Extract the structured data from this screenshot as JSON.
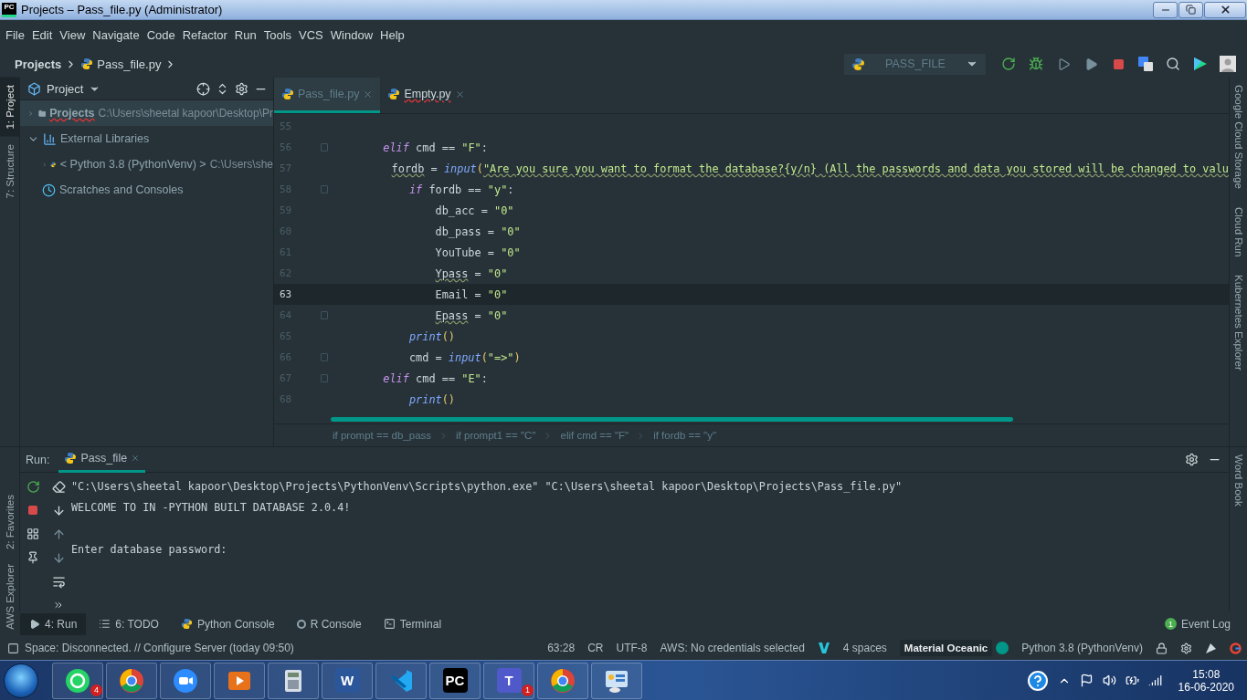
{
  "window": {
    "title": "Projects – Pass_file.py (Administrator)",
    "app_icon": "PC"
  },
  "menu": [
    "File",
    "Edit",
    "View",
    "Navigate",
    "Code",
    "Refactor",
    "Run",
    "Tools",
    "VCS",
    "Window",
    "Help"
  ],
  "breadcrumbs": [
    "Projects",
    "Pass_file.py"
  ],
  "run_config": {
    "label": "PASS_FILE"
  },
  "left_stripe": [
    {
      "label": "1: Project",
      "selected": true
    },
    {
      "label": "7: Structure",
      "selected": false
    }
  ],
  "project_panel": {
    "title": "Project",
    "tree": [
      {
        "label": "Projects",
        "path": "C:\\Users\\sheetal kapoor\\Desktop\\Pr",
        "kind": "folder",
        "expanded": false,
        "selected": true,
        "error": true
      },
      {
        "label": "External Libraries",
        "kind": "library",
        "expanded": true,
        "selected": false,
        "children": [
          {
            "label": "< Python 3.8 (PythonVenv) >",
            "path": "C:\\Users\\she",
            "kind": "python",
            "expanded": false,
            "selected": false
          }
        ]
      },
      {
        "label": "Scratches and Consoles",
        "kind": "scratches",
        "selected": false
      }
    ]
  },
  "editor_tabs": [
    {
      "label": "Pass_file.py",
      "selected": true,
      "error": false
    },
    {
      "label": "Empty.py",
      "selected": false,
      "error": true
    }
  ],
  "code_lines": [
    {
      "number": "55",
      "fold": false,
      "selected": false
    },
    {
      "number": "56",
      "fold": true,
      "selected": false,
      "tokens": [
        {
          "kind": "keyword",
          "text": "        elif"
        },
        {
          "kind": "plain",
          "text": " cmd == "
        },
        {
          "kind": "string",
          "text": "\"F\""
        },
        {
          "kind": "plain",
          "text": ":"
        }
      ]
    },
    {
      "number": "57",
      "fold": false,
      "selected": false,
      "tokens": [
        {
          "kind": "plain",
          "text": "            fordb",
          "squiggle": true
        },
        {
          "kind": "plain",
          "text": " = "
        },
        {
          "kind": "func",
          "text": "input"
        },
        {
          "kind": "bracket",
          "text": "("
        },
        {
          "kind": "string",
          "text": "\"Are you sure you want to format the database?{y/n} (All the passwords and data you stored will be changed to valu",
          "squiggle": true
        }
      ]
    },
    {
      "number": "58",
      "fold": true,
      "selected": false,
      "tokens": [
        {
          "kind": "keyword",
          "text": "            if"
        },
        {
          "kind": "plain",
          "text": " fordb == "
        },
        {
          "kind": "string",
          "text": "\"y\""
        },
        {
          "kind": "plain",
          "text": ":"
        }
      ]
    },
    {
      "number": "59",
      "fold": false,
      "selected": false,
      "tokens": [
        {
          "kind": "plain",
          "text": "                db_acc = "
        },
        {
          "kind": "string",
          "text": "\"0\""
        }
      ]
    },
    {
      "number": "60",
      "fold": false,
      "selected": false,
      "tokens": [
        {
          "kind": "plain",
          "text": "                db_pass = "
        },
        {
          "kind": "string",
          "text": "\"0\""
        }
      ]
    },
    {
      "number": "61",
      "fold": false,
      "selected": false,
      "tokens": [
        {
          "kind": "plain",
          "text": "                YouTube = "
        },
        {
          "kind": "string",
          "text": "\"0\""
        }
      ]
    },
    {
      "number": "62",
      "fold": false,
      "selected": false,
      "tokens": [
        {
          "kind": "plain",
          "text": "                Ypass",
          "squiggle": true
        },
        {
          "kind": "plain",
          "text": " = "
        },
        {
          "kind": "string",
          "text": "\"0\""
        }
      ]
    },
    {
      "number": "63",
      "fold": false,
      "selected": true,
      "tokens": [
        {
          "kind": "plain",
          "text": "                Email = "
        },
        {
          "kind": "string",
          "text": "\"0\""
        }
      ]
    },
    {
      "number": "64",
      "fold": true,
      "selected": false,
      "tokens": [
        {
          "kind": "plain",
          "text": "                Epass",
          "squiggle": true
        },
        {
          "kind": "plain",
          "text": " = "
        },
        {
          "kind": "string",
          "text": "\"0\""
        }
      ]
    },
    {
      "number": "65",
      "fold": false,
      "selected": false,
      "tokens": [
        {
          "kind": "func",
          "text": "            print"
        },
        {
          "kind": "bracket",
          "text": "()"
        }
      ]
    },
    {
      "number": "66",
      "fold": true,
      "selected": false,
      "tokens": [
        {
          "kind": "plain",
          "text": "            cmd = "
        },
        {
          "kind": "func",
          "text": "input"
        },
        {
          "kind": "bracket",
          "text": "("
        },
        {
          "kind": "string",
          "text": "\"=>\""
        },
        {
          "kind": "bracket",
          "text": ")"
        }
      ]
    },
    {
      "number": "67",
      "fold": true,
      "selected": false,
      "tokens": [
        {
          "kind": "keyword",
          "text": "        elif"
        },
        {
          "kind": "plain",
          "text": " cmd == "
        },
        {
          "kind": "string",
          "text": "\"E\""
        },
        {
          "kind": "plain",
          "text": ":"
        }
      ]
    },
    {
      "number": "68",
      "fold": false,
      "selected": false,
      "tokens": [
        {
          "kind": "func",
          "text": "            print"
        },
        {
          "kind": "bracket",
          "text": "()"
        }
      ]
    }
  ],
  "code_breadcrumbs": [
    "if prompt == db_pass",
    "if prompt1 == \"C\"",
    "elif cmd == \"F\"",
    "if fordb == \"y\""
  ],
  "right_stripe": [
    "Google Cloud Storage",
    "Cloud Run",
    "Kubernetes Explorer"
  ],
  "run_panel": {
    "label": "Run:",
    "tab": {
      "label": "Pass_file",
      "selected": true
    },
    "side_tabs": [
      "2: Favorites",
      "AWS Explorer"
    ],
    "right_tab": "Word Book",
    "output": "\"C:\\Users\\sheetal kapoor\\Desktop\\Projects\\PythonVenv\\Scripts\\python.exe\" \"C:\\Users\\sheetal kapoor\\Desktop\\Projects\\Pass_file.py\"\nWELCOME TO IN -PYTHON BUILT DATABASE 2.0.4!\n\nEnter database password:"
  },
  "tool_windows": [
    {
      "label": "4: Run",
      "kind": "run",
      "selected": true
    },
    {
      "label": "6: TODO",
      "kind": "todo",
      "selected": false
    },
    {
      "label": "Python Console",
      "kind": "python",
      "selected": false
    },
    {
      "label": "R Console",
      "kind": "r",
      "selected": false
    },
    {
      "label": "Terminal",
      "kind": "terminal",
      "selected": false
    }
  ],
  "event_log": {
    "label": "Event Log",
    "badge": "1"
  },
  "status_bar": {
    "message": "Space: Disconnected. // Configure Server (today 09:50)",
    "position": "63:28",
    "line_separator": "CR",
    "encoding": "UTF-8",
    "aws": "AWS: No credentials selected",
    "indent": "4 spaces",
    "theme": "Material Oceanic",
    "interpreter": "Python 3.8 (PythonVenv)"
  },
  "taskbar": {
    "apps": [
      {
        "kind": "whatsapp",
        "badge": "4"
      },
      {
        "kind": "chrome"
      },
      {
        "kind": "zoom"
      },
      {
        "kind": "media"
      },
      {
        "kind": "calculator"
      },
      {
        "kind": "word",
        "glyph": "W"
      },
      {
        "kind": "vscode"
      },
      {
        "kind": "pycharm",
        "glyph": "PC"
      },
      {
        "kind": "teams",
        "glyph": "T",
        "badge": "1"
      },
      {
        "kind": "chrome"
      },
      {
        "kind": "control-panel"
      }
    ],
    "time": "15:08",
    "date": "16-06-2020"
  }
}
